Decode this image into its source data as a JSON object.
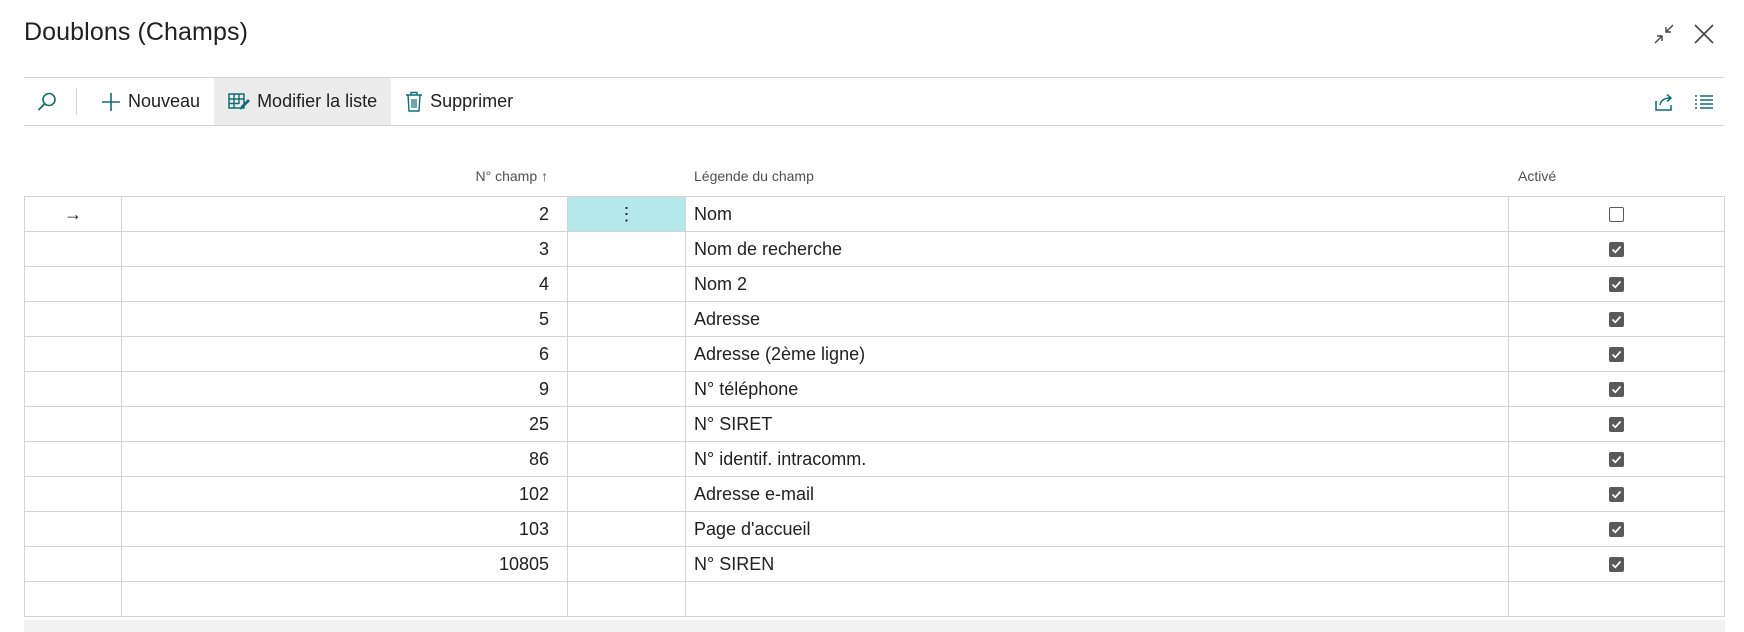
{
  "window": {
    "title": "Doublons (Champs)",
    "collapse_icon": "collapse-icon",
    "close_icon": "close-icon"
  },
  "toolbar": {
    "search_icon": "search-icon",
    "new_label": "Nouveau",
    "edit_list_label": "Modifier la liste",
    "delete_label": "Supprimer",
    "share_icon": "share-icon",
    "list_view_icon": "list-view-icon"
  },
  "table": {
    "columns": {
      "field_no": "N° champ",
      "caption": "Légende du champ",
      "enabled": "Activé"
    },
    "sort_indicator": "↑",
    "current_row_marker": "→",
    "row_menu_glyph": "⋮",
    "rows": [
      {
        "field_no": "2",
        "caption": "Nom",
        "enabled": false,
        "current": true
      },
      {
        "field_no": "3",
        "caption": "Nom de recherche",
        "enabled": true
      },
      {
        "field_no": "4",
        "caption": "Nom 2",
        "enabled": true
      },
      {
        "field_no": "5",
        "caption": "Adresse",
        "enabled": true
      },
      {
        "field_no": "6",
        "caption": "Adresse (2ème ligne)",
        "enabled": true
      },
      {
        "field_no": "9",
        "caption": "N° téléphone",
        "enabled": true
      },
      {
        "field_no": "25",
        "caption": "N° SIRET",
        "enabled": true
      },
      {
        "field_no": "86",
        "caption": "N° identif. intracomm.",
        "enabled": true
      },
      {
        "field_no": "102",
        "caption": "Adresse e-mail",
        "enabled": true
      },
      {
        "field_no": "103",
        "caption": "Page d'accueil",
        "enabled": true
      },
      {
        "field_no": "10805",
        "caption": "N° SIREN",
        "enabled": true
      }
    ]
  },
  "colors": {
    "accent": "#0e6f77",
    "selected_cell": "#b5e8ea",
    "checkbox": "#5a5a5a"
  }
}
